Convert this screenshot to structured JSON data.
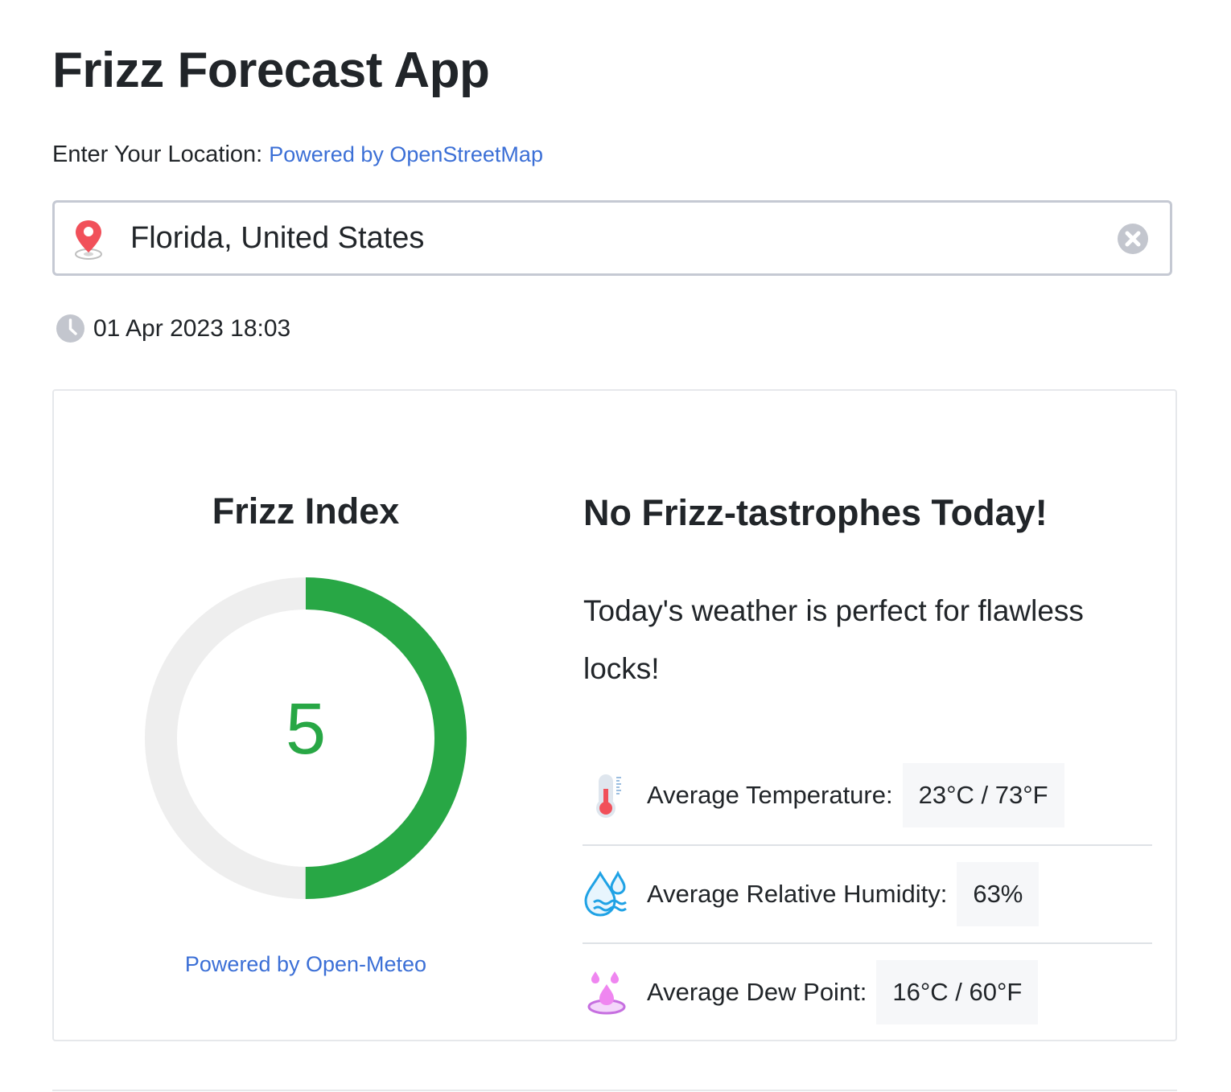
{
  "app": {
    "title": "Frizz Forecast App"
  },
  "location": {
    "label": "Enter Your Location:",
    "powered_by": "Powered by OpenStreetMap",
    "value": "Florida, United States"
  },
  "timestamp": "01 Apr 2023 18:03",
  "frizz_index": {
    "title": "Frizz Index",
    "value": "5",
    "fill_fraction": 0.5,
    "color": "#28a745",
    "track_color": "#eeeeee",
    "powered_by": "Powered by Open-Meteo"
  },
  "forecast": {
    "title": "No Frizz-tastrophes Today!",
    "message": "Today's weather is perfect for flawless locks!",
    "stats": [
      {
        "icon": "thermometer-icon",
        "label": "Average Temperature:",
        "value": "23°C / 73°F"
      },
      {
        "icon": "humidity-icon",
        "label": "Average Relative Humidity:",
        "value": "63%"
      },
      {
        "icon": "dew-point-icon",
        "label": "Average Dew Point:",
        "value": "16°C / 60°F"
      }
    ]
  },
  "colors": {
    "link": "#3b6fd6",
    "accent": "#28a745",
    "input_border": "#c5c9d3"
  }
}
